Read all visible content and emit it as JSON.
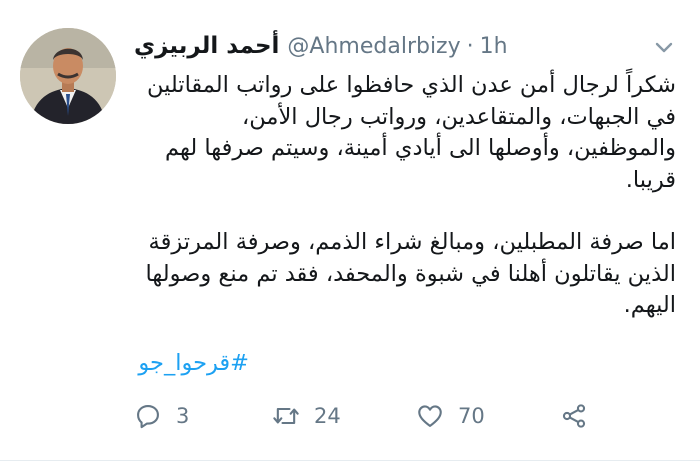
{
  "tweet": {
    "display_name": "أحمد الربيزي",
    "handle": "@Ahmedalrbizy",
    "separator": "·",
    "time": "1h",
    "paragraph_1": "شكراً لرجال أمن عدن الذي حافظوا على رواتب المقاتلين في الجبهات، والمتقاعدين، ورواتب رجال الأمن، والموظفين، وأوصلها الى أيادي أمينة، وسيتم صرفها لهم قريبا.",
    "paragraph_2": "اما صرفة المطبلين، ومبالغ شراء الذمم، وصرفة المرتزقة الذين يقاتلون أهلنا في شبوة والمحفد، فقد تم منع وصولها اليهم.",
    "hashtag": "#قرحوا_جو"
  },
  "actions": {
    "reply_count": "3",
    "retweet_count": "24",
    "like_count": "70"
  },
  "icons": {
    "caret": "chevron-down-icon",
    "reply": "reply-icon",
    "retweet": "retweet-icon",
    "like": "heart-icon",
    "share": "share-icon"
  },
  "colors": {
    "link": "#1da1f2",
    "secondary_text": "#657786",
    "primary_text": "#14171a"
  }
}
